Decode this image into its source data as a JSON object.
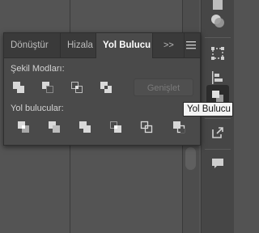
{
  "panel": {
    "tabs": [
      {
        "label": "Dönüştür",
        "active": false
      },
      {
        "label": "Hizala",
        "active": false
      },
      {
        "label": "Yol Bulucu",
        "active": true
      }
    ],
    "more_glyph": ">>",
    "shape_modes_label": "Şekil Modları:",
    "shape_modes": [
      "unite-icon",
      "minus-front-icon",
      "intersect-icon",
      "exclude-icon"
    ],
    "expand_label": "Genişlet",
    "pathfinders_label": "Yol bulucular:",
    "pathfinders": [
      "divide-icon",
      "trim-icon",
      "merge-icon",
      "crop-icon",
      "outline-icon",
      "minus-back-icon"
    ]
  },
  "tooltip": {
    "text": "Yol Bulucu"
  },
  "toolbar": {
    "tools": [
      "color-guide-icon",
      "transparency-icon",
      "transform-icon",
      "align-icon",
      "pathfinder-icon",
      "export-icon",
      "comments-icon"
    ],
    "active_tool": "pathfinder-icon"
  },
  "colors": {
    "panel_bg": "#4a4a4a",
    "tab_bg": "#3a3a3a",
    "tooltip_bg": "#f4f4f4",
    "icon": "#d9d9d9"
  }
}
